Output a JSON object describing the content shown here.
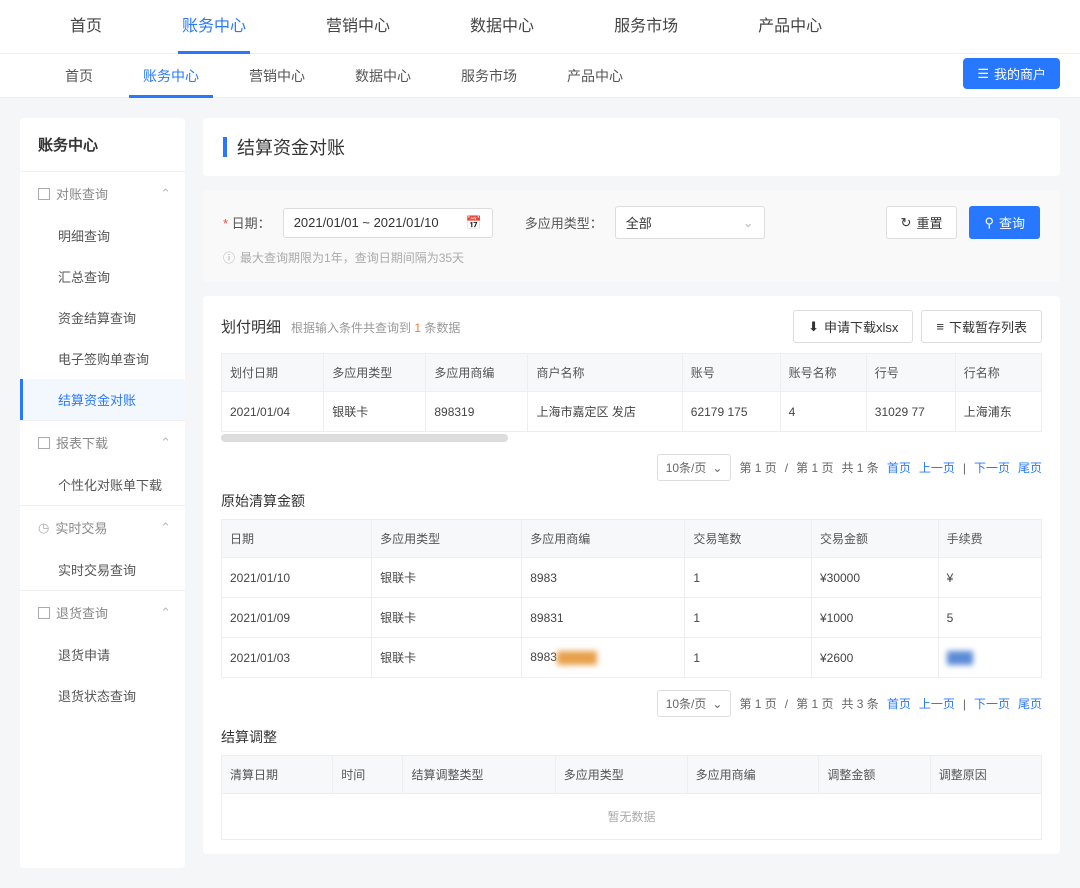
{
  "topNav": {
    "items": [
      "首页",
      "账务中心",
      "营销中心",
      "数据中心",
      "服务市场",
      "产品中心"
    ],
    "active": 1
  },
  "subNav": {
    "items": [
      "首页",
      "账务中心",
      "营销中心",
      "数据中心",
      "服务市场",
      "产品中心"
    ],
    "active": 1,
    "merchant": "我的商户"
  },
  "sidebar": {
    "title": "账务中心",
    "groups": [
      {
        "title": "对账查询",
        "items": [
          "明细查询",
          "汇总查询",
          "资金结算查询",
          "电子签购单查询",
          "结算资金对账"
        ],
        "active": 4
      },
      {
        "title": "报表下载",
        "items": [
          "个性化对账单下载"
        ]
      },
      {
        "title": "实时交易",
        "items": [
          "实时交易查询"
        ]
      },
      {
        "title": "退货查询",
        "items": [
          "退货申请",
          "退货状态查询"
        ]
      }
    ]
  },
  "pageTitle": "结算资金对账",
  "query": {
    "dateLabel": "日期：",
    "dateValue": "2021/01/01 ~ 2021/01/10",
    "typeLabel": "多应用类型：",
    "typeValue": "全部",
    "reset": "重置",
    "search": "查询",
    "hint": "最大查询期限为1年，查询日期间隔为35天"
  },
  "detail": {
    "title": "划付明细",
    "meta_pre": "根据输入条件共查询到",
    "count": "1",
    "meta_suf": "条数据",
    "dlXlsx": "申请下载xlsx",
    "dlTemp": "下载暂存列表",
    "cols": [
      "划付日期",
      "多应用类型",
      "多应用商编",
      "商户名称",
      "账号",
      "账号名称",
      "行号",
      "行名称"
    ],
    "rows": [
      [
        "2021/01/04",
        "银联卡",
        "898319",
        "上海市嘉定区        发店",
        "62179       175",
        "    4",
        "31029      77",
        "上海浦东"
      ]
    ]
  },
  "orig": {
    "title": "原始清算金额",
    "cols": [
      "日期",
      "多应用类型",
      "多应用商编",
      "交易笔数",
      "交易金额",
      "手续费"
    ],
    "rows": [
      [
        "2021/01/10",
        "银联卡",
        "8983",
        "1",
        "¥30000",
        "¥"
      ],
      [
        "2021/01/09",
        "银联卡",
        "89831",
        "1",
        "¥1000",
        "5"
      ],
      [
        "2021/01/03",
        "银联卡",
        "8983",
        "1",
        "¥2600",
        ""
      ]
    ]
  },
  "adjust": {
    "title": "结算调整",
    "cols": [
      "清算日期",
      "时间",
      "结算调整类型",
      "多应用类型",
      "多应用商编",
      "调整金额",
      "调整原因"
    ],
    "empty": "暂无数据"
  },
  "pager": {
    "size": "10条/页",
    "p1": "第 1 页",
    "p2": "第 1 页",
    "t1": "共 1 条",
    "t3": "共 3 条",
    "first": "首页",
    "prev": "上一页",
    "next": "下一页",
    "last": "尾页"
  }
}
